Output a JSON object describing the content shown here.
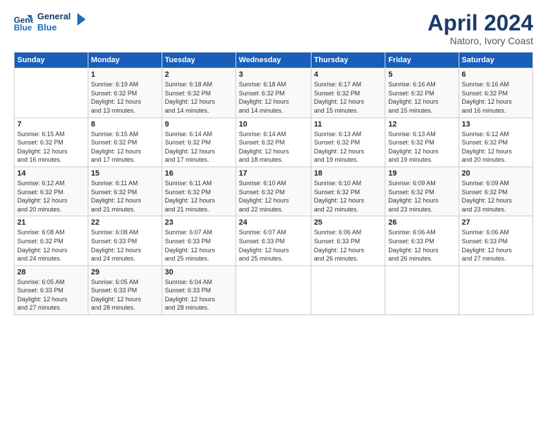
{
  "logo": {
    "line1": "General",
    "line2": "Blue"
  },
  "title": "April 2024",
  "location": "Natoro, Ivory Coast",
  "days_header": [
    "Sunday",
    "Monday",
    "Tuesday",
    "Wednesday",
    "Thursday",
    "Friday",
    "Saturday"
  ],
  "weeks": [
    [
      {
        "day": "",
        "info": ""
      },
      {
        "day": "1",
        "info": "Sunrise: 6:19 AM\nSunset: 6:32 PM\nDaylight: 12 hours\nand 13 minutes."
      },
      {
        "day": "2",
        "info": "Sunrise: 6:18 AM\nSunset: 6:32 PM\nDaylight: 12 hours\nand 14 minutes."
      },
      {
        "day": "3",
        "info": "Sunrise: 6:18 AM\nSunset: 6:32 PM\nDaylight: 12 hours\nand 14 minutes."
      },
      {
        "day": "4",
        "info": "Sunrise: 6:17 AM\nSunset: 6:32 PM\nDaylight: 12 hours\nand 15 minutes."
      },
      {
        "day": "5",
        "info": "Sunrise: 6:16 AM\nSunset: 6:32 PM\nDaylight: 12 hours\nand 15 minutes."
      },
      {
        "day": "6",
        "info": "Sunrise: 6:16 AM\nSunset: 6:32 PM\nDaylight: 12 hours\nand 16 minutes."
      }
    ],
    [
      {
        "day": "7",
        "info": "Sunrise: 6:15 AM\nSunset: 6:32 PM\nDaylight: 12 hours\nand 16 minutes."
      },
      {
        "day": "8",
        "info": "Sunrise: 6:15 AM\nSunset: 6:32 PM\nDaylight: 12 hours\nand 17 minutes."
      },
      {
        "day": "9",
        "info": "Sunrise: 6:14 AM\nSunset: 6:32 PM\nDaylight: 12 hours\nand 17 minutes."
      },
      {
        "day": "10",
        "info": "Sunrise: 6:14 AM\nSunset: 6:32 PM\nDaylight: 12 hours\nand 18 minutes."
      },
      {
        "day": "11",
        "info": "Sunrise: 6:13 AM\nSunset: 6:32 PM\nDaylight: 12 hours\nand 19 minutes."
      },
      {
        "day": "12",
        "info": "Sunrise: 6:13 AM\nSunset: 6:32 PM\nDaylight: 12 hours\nand 19 minutes."
      },
      {
        "day": "13",
        "info": "Sunrise: 6:12 AM\nSunset: 6:32 PM\nDaylight: 12 hours\nand 20 minutes."
      }
    ],
    [
      {
        "day": "14",
        "info": "Sunrise: 6:12 AM\nSunset: 6:32 PM\nDaylight: 12 hours\nand 20 minutes."
      },
      {
        "day": "15",
        "info": "Sunrise: 6:11 AM\nSunset: 6:32 PM\nDaylight: 12 hours\nand 21 minutes."
      },
      {
        "day": "16",
        "info": "Sunrise: 6:11 AM\nSunset: 6:32 PM\nDaylight: 12 hours\nand 21 minutes."
      },
      {
        "day": "17",
        "info": "Sunrise: 6:10 AM\nSunset: 6:32 PM\nDaylight: 12 hours\nand 22 minutes."
      },
      {
        "day": "18",
        "info": "Sunrise: 6:10 AM\nSunset: 6:32 PM\nDaylight: 12 hours\nand 22 minutes."
      },
      {
        "day": "19",
        "info": "Sunrise: 6:09 AM\nSunset: 6:32 PM\nDaylight: 12 hours\nand 23 minutes."
      },
      {
        "day": "20",
        "info": "Sunrise: 6:09 AM\nSunset: 6:32 PM\nDaylight: 12 hours\nand 23 minutes."
      }
    ],
    [
      {
        "day": "21",
        "info": "Sunrise: 6:08 AM\nSunset: 6:32 PM\nDaylight: 12 hours\nand 24 minutes."
      },
      {
        "day": "22",
        "info": "Sunrise: 6:08 AM\nSunset: 6:33 PM\nDaylight: 12 hours\nand 24 minutes."
      },
      {
        "day": "23",
        "info": "Sunrise: 6:07 AM\nSunset: 6:33 PM\nDaylight: 12 hours\nand 25 minutes."
      },
      {
        "day": "24",
        "info": "Sunrise: 6:07 AM\nSunset: 6:33 PM\nDaylight: 12 hours\nand 25 minutes."
      },
      {
        "day": "25",
        "info": "Sunrise: 6:06 AM\nSunset: 6:33 PM\nDaylight: 12 hours\nand 26 minutes."
      },
      {
        "day": "26",
        "info": "Sunrise: 6:06 AM\nSunset: 6:33 PM\nDaylight: 12 hours\nand 26 minutes."
      },
      {
        "day": "27",
        "info": "Sunrise: 6:06 AM\nSunset: 6:33 PM\nDaylight: 12 hours\nand 27 minutes."
      }
    ],
    [
      {
        "day": "28",
        "info": "Sunrise: 6:05 AM\nSunset: 6:33 PM\nDaylight: 12 hours\nand 27 minutes."
      },
      {
        "day": "29",
        "info": "Sunrise: 6:05 AM\nSunset: 6:33 PM\nDaylight: 12 hours\nand 28 minutes."
      },
      {
        "day": "30",
        "info": "Sunrise: 6:04 AM\nSunset: 6:33 PM\nDaylight: 12 hours\nand 28 minutes."
      },
      {
        "day": "",
        "info": ""
      },
      {
        "day": "",
        "info": ""
      },
      {
        "day": "",
        "info": ""
      },
      {
        "day": "",
        "info": ""
      }
    ]
  ]
}
